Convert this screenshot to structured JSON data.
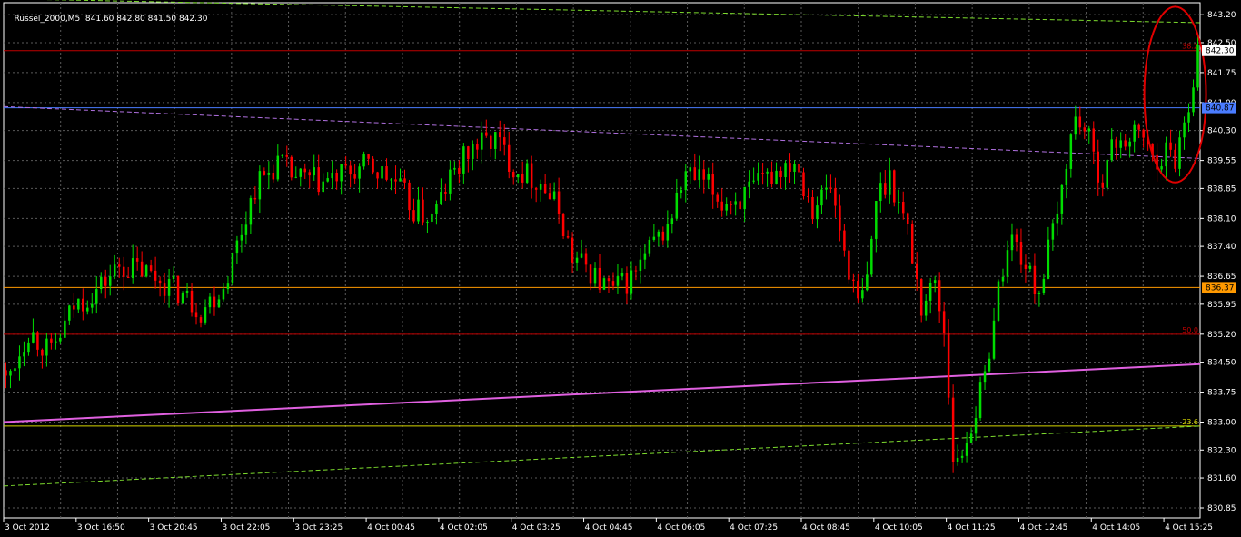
{
  "header": {
    "symbol": "Russel_2000,M5",
    "ohlc": "841.60 842.80 841.50 842.30"
  },
  "chart_data": {
    "type": "candlestick",
    "symbol": "Russel_2000",
    "timeframe": "M5",
    "bar_count": 264,
    "ylim": [
      830.6,
      843.5
    ],
    "y_ticks": [
      "843.20",
      "842.50",
      "841.75",
      "841.00",
      "840.30",
      "839.55",
      "838.85",
      "838.10",
      "837.40",
      "836.65",
      "835.95",
      "835.20",
      "834.50",
      "833.75",
      "833.00",
      "832.30",
      "831.60",
      "830.85"
    ],
    "x_ticks": [
      {
        "bar": 0,
        "label": "3 Oct 2012"
      },
      {
        "bar": 16,
        "label": "3 Oct 16:50"
      },
      {
        "bar": 32,
        "label": "3 Oct 20:45"
      },
      {
        "bar": 48,
        "label": "3 Oct 22:05"
      },
      {
        "bar": 64,
        "label": "3 Oct 23:25"
      },
      {
        "bar": 80,
        "label": "4 Oct 00:45"
      },
      {
        "bar": 96,
        "label": "4 Oct 02:05"
      },
      {
        "bar": 112,
        "label": "4 Oct 03:25"
      },
      {
        "bar": 128,
        "label": "4 Oct 04:45"
      },
      {
        "bar": 144,
        "label": "4 Oct 06:05"
      },
      {
        "bar": 160,
        "label": "4 Oct 07:25"
      },
      {
        "bar": 176,
        "label": "4 Oct 08:45"
      },
      {
        "bar": 192,
        "label": "4 Oct 10:05"
      },
      {
        "bar": 208,
        "label": "4 Oct 11:25"
      },
      {
        "bar": 224,
        "label": "4 Oct 12:45"
      },
      {
        "bar": 240,
        "label": "4 Oct 14:05"
      },
      {
        "bar": 256,
        "label": "4 Oct 15:25"
      }
    ],
    "close_path": [
      [
        0,
        834.0
      ],
      [
        5,
        835.3
      ],
      [
        10,
        834.7
      ],
      [
        15,
        835.9
      ],
      [
        20,
        836.3
      ],
      [
        25,
        836.9
      ],
      [
        30,
        836.8
      ],
      [
        35,
        836.5
      ],
      [
        40,
        836.1
      ],
      [
        43,
        835.8
      ],
      [
        48,
        836.4
      ],
      [
        52,
        837.8
      ],
      [
        55,
        838.9
      ],
      [
        60,
        839.5
      ],
      [
        64,
        839.1
      ],
      [
        70,
        839.0
      ],
      [
        75,
        839.2
      ],
      [
        80,
        839.4
      ],
      [
        86,
        839.0
      ],
      [
        90,
        838.3
      ],
      [
        94,
        838.1
      ],
      [
        98,
        839.1
      ],
      [
        103,
        839.9
      ],
      [
        108,
        840.1
      ],
      [
        112,
        839.4
      ],
      [
        118,
        839.0
      ],
      [
        122,
        838.3
      ],
      [
        125,
        837.1
      ],
      [
        128,
        836.9
      ],
      [
        131,
        836.5
      ],
      [
        134,
        836.3
      ],
      [
        138,
        836.6
      ],
      [
        142,
        837.3
      ],
      [
        146,
        837.9
      ],
      [
        150,
        839.2
      ],
      [
        154,
        839.0
      ],
      [
        158,
        838.5
      ],
      [
        162,
        838.6
      ],
      [
        166,
        838.9
      ],
      [
        170,
        839.3
      ],
      [
        174,
        839.6
      ],
      [
        178,
        838.4
      ],
      [
        182,
        838.9
      ],
      [
        185,
        837.3
      ],
      [
        188,
        835.9
      ],
      [
        190,
        836.5
      ],
      [
        192,
        838.6
      ],
      [
        195,
        839.2
      ],
      [
        199,
        837.8
      ],
      [
        202,
        835.9
      ],
      [
        205,
        836.5
      ],
      [
        207,
        835.3
      ],
      [
        208,
        833.8
      ],
      [
        209,
        832.2
      ],
      [
        210,
        831.9
      ],
      [
        212,
        832.6
      ],
      [
        214,
        833.3
      ],
      [
        216,
        834.1
      ],
      [
        218,
        835.7
      ],
      [
        220,
        836.9
      ],
      [
        222,
        837.6
      ],
      [
        224,
        837.2
      ],
      [
        226,
        836.6
      ],
      [
        228,
        836.3
      ],
      [
        230,
        837.3
      ],
      [
        232,
        838.1
      ],
      [
        234,
        839.6
      ],
      [
        236,
        840.6
      ],
      [
        238,
        840.4
      ],
      [
        240,
        839.6
      ],
      [
        242,
        839.1
      ],
      [
        244,
        839.8
      ],
      [
        246,
        840.2
      ],
      [
        248,
        839.9
      ],
      [
        250,
        840.4
      ],
      [
        252,
        839.8
      ],
      [
        254,
        839.6
      ],
      [
        256,
        839.8
      ],
      [
        258,
        839.6
      ],
      [
        261,
        841.0
      ],
      [
        263,
        842.3
      ]
    ],
    "overlay_lines": [
      {
        "name": "fib-38.2",
        "label": "38.2",
        "color": "#c00000",
        "y0": 842.3,
        "y1": 842.3
      },
      {
        "name": "fib-50.0",
        "label": "50.0",
        "color": "#c00000",
        "y0": 835.2,
        "y1": 835.2
      },
      {
        "name": "fib-23.6",
        "label": "23.6",
        "color": "#d6d600",
        "y0": 832.9,
        "y1": 832.9
      },
      {
        "name": "support-orange",
        "label": "",
        "color": "#ff9900",
        "y0": 836.37,
        "y1": 836.37
      },
      {
        "name": "resistance-blue",
        "label": "",
        "color": "#4a7cff",
        "y0": 840.87,
        "y1": 840.87
      },
      {
        "name": "trend-magenta",
        "label": "",
        "color": "#e060e0",
        "y0": 833.0,
        "y1": 834.45
      },
      {
        "name": "trend-violet-upper",
        "label": "",
        "color": "#b070e0",
        "y0": 840.9,
        "y1": 839.6
      },
      {
        "name": "channel-green-lower",
        "label": "",
        "color": "#7ddc2e",
        "y0": 831.4,
        "y1": 832.9
      },
      {
        "name": "channel-green-upper",
        "label": "",
        "color": "#7ddc2e",
        "y0": 843.6,
        "y1": 843.0
      }
    ],
    "price_badges": [
      {
        "value": "842.30",
        "y": 842.3,
        "bg": "#ffffff",
        "fg": "#000000"
      },
      {
        "value": "840.87",
        "y": 840.87,
        "bg": "#4a7cff",
        "fg": "#000000"
      },
      {
        "value": "836.37",
        "y": 836.37,
        "bg": "#ff9900",
        "fg": "#000000"
      }
    ],
    "annotation": {
      "shape": "ellipse",
      "color": "#e00000",
      "near_bar": 258,
      "y_top": 843.4,
      "y_bottom": 839.0
    },
    "colors": {
      "up": "#00dd00",
      "down": "#ff0000",
      "grid": "#5a5a5a",
      "axis": "#ffffff",
      "background": "#000000"
    },
    "grid": true
  }
}
